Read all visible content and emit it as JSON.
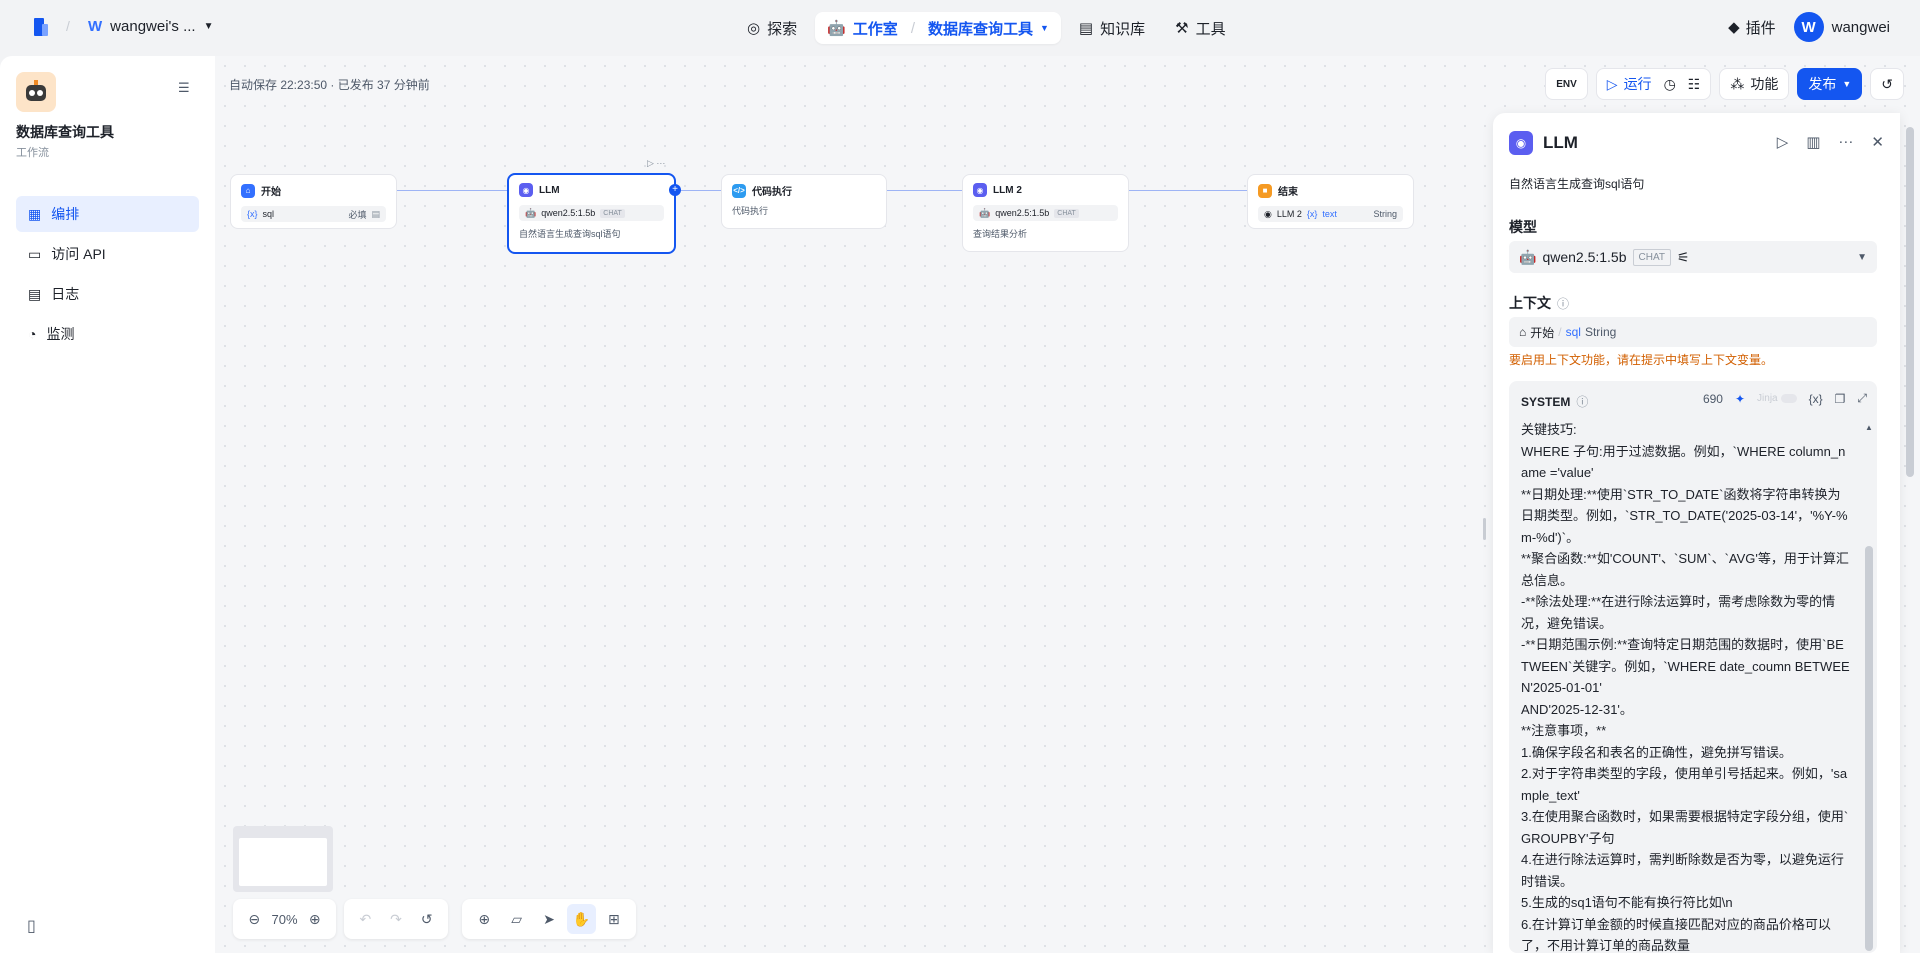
{
  "header": {
    "workspace": "wangwei's ...",
    "workspace_initial": "W",
    "nav": {
      "explore": "探索",
      "studio": "工作室",
      "current_app": "数据库查询工具",
      "knowledge": "知识库",
      "tools": "工具"
    },
    "plugins": "插件",
    "user_initial": "W",
    "user_name": "wangwei"
  },
  "sidebar": {
    "app_title": "数据库查询工具",
    "app_type": "工作流",
    "items": [
      {
        "label": "编排",
        "active": true
      },
      {
        "label": "访问 API",
        "active": false
      },
      {
        "label": "日志",
        "active": false
      },
      {
        "label": "监测",
        "active": false
      }
    ]
  },
  "canvas": {
    "autosave": "自动保存 22:23:50 · 已发布 37 分钟前",
    "actions": {
      "env": "ENV",
      "run": "运行",
      "features": "功能",
      "publish": "发布"
    },
    "nodes": {
      "start": {
        "title": "开始",
        "var": "sql",
        "required": "必填"
      },
      "llm": {
        "title": "LLM",
        "model": "qwen2.5:1.5b",
        "mode": "CHAT",
        "desc": "自然语言生成查询sql语句"
      },
      "code": {
        "title": "代码执行",
        "desc": "代码执行"
      },
      "llm2": {
        "title": "LLM 2",
        "model": "qwen2.5:1.5b",
        "mode": "CHAT",
        "desc": "查询结果分析"
      },
      "end": {
        "title": "结束",
        "src": "LLM 2",
        "var": "text",
        "type": "String"
      }
    },
    "zoom": "70%"
  },
  "panel": {
    "title": "LLM",
    "desc": "自然语言生成查询sql语句",
    "model_label": "模型",
    "model_name": "qwen2.5:1.5b",
    "model_mode": "CHAT",
    "context_label": "上下文",
    "context_source": "开始",
    "context_var": "sql",
    "context_type": "String",
    "warning": "要启用上下文功能，请在提示中填写上下文变量。",
    "system_label": "SYSTEM",
    "token_count": "690",
    "jinja": "Jinja",
    "var_btn": "{x}",
    "system_lines": [
      "关键技巧:",
      "WHERE 子句:用于过滤数据。例如，`WHERE column_name ='value'",
      "**日期处理:**使用`STR_TO_DATE`函数将字符串转换为日期类型。例如，`STR_TO_DATE('2025-03-14'，'%Y-%m-%d')`。",
      "**聚合函数:**如'COUNT'、`SUM`、`AVG'等，用于计算汇总信息。",
      "-**除法处理:**在进行除法运算时，需考虑除数为零的情况，避免错误。",
      "-**日期范围示例:**查询特定日期范围的数据时，使用`BETWEEN`关键字。例如，`WHERE date_coumn BETWEEN'2025-01-01'",
      "AND'2025-12-31'。",
      "**注意事项，**",
      "1.确保字段名和表名的正确性，避免拼写错误。",
      "2.对于字符串类型的字段，使用单引号括起来。例如，'sample_text'",
      "3.在使用聚合函数时，如果需要根据特定字段分组，使用`GROUPBY'子句",
      "4.在进行除法运算时，需判断除数是否为零，以避免运行时错误。",
      "5.生成的sq1语句不能有换行符比如\\n",
      "6.在计算订单金额的时候直接匹配对应的商品价格可以了，不用计算订单的商品数量"
    ]
  },
  "colors": {
    "accent": "#1456f0",
    "warning": "#d25f00"
  }
}
